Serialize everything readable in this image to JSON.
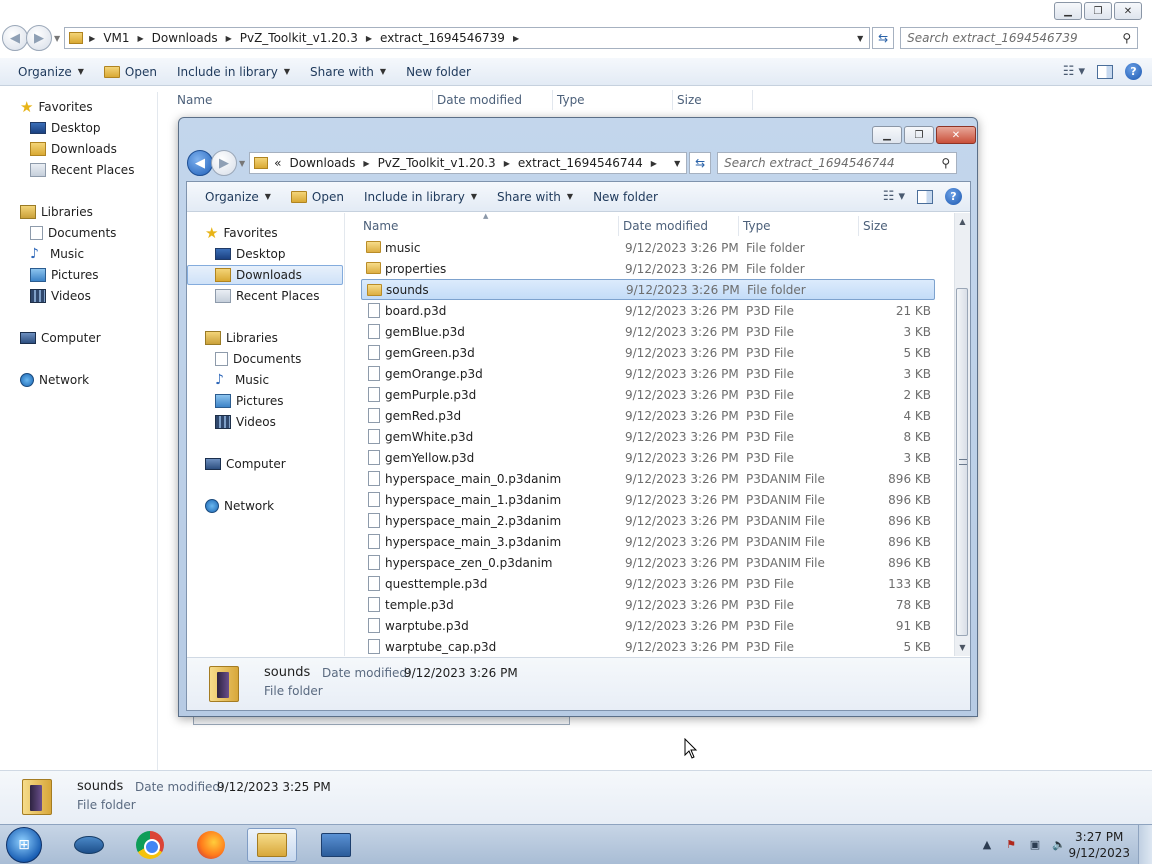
{
  "background_window": {
    "address": {
      "crumbs": [
        "VM1",
        "Downloads",
        "PvZ_Toolkit_v1.20.3",
        "extract_1694546739"
      ]
    },
    "search_placeholder": "Search extract_1694546739",
    "toolbar": {
      "organize": "Organize",
      "open": "Open",
      "include_in_library": "Include in library",
      "share_with": "Share with",
      "new_folder": "New folder"
    },
    "columns": [
      "Name",
      "Date modified",
      "Type",
      "Size"
    ],
    "nav": {
      "favorites": "Favorites",
      "desktop": "Desktop",
      "downloads": "Downloads",
      "recent_places": "Recent Places",
      "libraries": "Libraries",
      "documents": "Documents",
      "music": "Music",
      "pictures": "Pictures",
      "videos": "Videos",
      "computer": "Computer",
      "network": "Network"
    },
    "details": {
      "name": "sounds",
      "date_label": "Date modified:",
      "date_value": "9/12/2023 3:25 PM",
      "type": "File folder"
    }
  },
  "foreground_window": {
    "address": {
      "overflow": "«",
      "crumbs": [
        "Downloads",
        "PvZ_Toolkit_v1.20.3",
        "extract_1694546744"
      ]
    },
    "search_placeholder": "Search extract_1694546744",
    "toolbar": {
      "organize": "Organize",
      "open": "Open",
      "include_in_library": "Include in library",
      "share_with": "Share with",
      "new_folder": "New folder"
    },
    "columns": [
      "Name",
      "Date modified",
      "Type",
      "Size"
    ],
    "nav": {
      "favorites": "Favorites",
      "desktop": "Desktop",
      "downloads": "Downloads",
      "recent_places": "Recent Places",
      "libraries": "Libraries",
      "documents": "Documents",
      "music": "Music",
      "pictures": "Pictures",
      "videos": "Videos",
      "computer": "Computer",
      "network": "Network"
    },
    "files": [
      {
        "name": "music",
        "date": "9/12/2023 3:26 PM",
        "type": "File folder",
        "size": "",
        "kind": "folder"
      },
      {
        "name": "properties",
        "date": "9/12/2023 3:26 PM",
        "type": "File folder",
        "size": "",
        "kind": "folder"
      },
      {
        "name": "sounds",
        "date": "9/12/2023 3:26 PM",
        "type": "File folder",
        "size": "",
        "kind": "folder",
        "selected": true
      },
      {
        "name": "board.p3d",
        "date": "9/12/2023 3:26 PM",
        "type": "P3D File",
        "size": "21 KB",
        "kind": "file"
      },
      {
        "name": "gemBlue.p3d",
        "date": "9/12/2023 3:26 PM",
        "type": "P3D File",
        "size": "3 KB",
        "kind": "file"
      },
      {
        "name": "gemGreen.p3d",
        "date": "9/12/2023 3:26 PM",
        "type": "P3D File",
        "size": "5 KB",
        "kind": "file"
      },
      {
        "name": "gemOrange.p3d",
        "date": "9/12/2023 3:26 PM",
        "type": "P3D File",
        "size": "3 KB",
        "kind": "file"
      },
      {
        "name": "gemPurple.p3d",
        "date": "9/12/2023 3:26 PM",
        "type": "P3D File",
        "size": "2 KB",
        "kind": "file"
      },
      {
        "name": "gemRed.p3d",
        "date": "9/12/2023 3:26 PM",
        "type": "P3D File",
        "size": "4 KB",
        "kind": "file"
      },
      {
        "name": "gemWhite.p3d",
        "date": "9/12/2023 3:26 PM",
        "type": "P3D File",
        "size": "8 KB",
        "kind": "file"
      },
      {
        "name": "gemYellow.p3d",
        "date": "9/12/2023 3:26 PM",
        "type": "P3D File",
        "size": "3 KB",
        "kind": "file"
      },
      {
        "name": "hyperspace_main_0.p3danim",
        "date": "9/12/2023 3:26 PM",
        "type": "P3DANIM File",
        "size": "896 KB",
        "kind": "file"
      },
      {
        "name": "hyperspace_main_1.p3danim",
        "date": "9/12/2023 3:26 PM",
        "type": "P3DANIM File",
        "size": "896 KB",
        "kind": "file"
      },
      {
        "name": "hyperspace_main_2.p3danim",
        "date": "9/12/2023 3:26 PM",
        "type": "P3DANIM File",
        "size": "896 KB",
        "kind": "file"
      },
      {
        "name": "hyperspace_main_3.p3danim",
        "date": "9/12/2023 3:26 PM",
        "type": "P3DANIM File",
        "size": "896 KB",
        "kind": "file"
      },
      {
        "name": "hyperspace_zen_0.p3danim",
        "date": "9/12/2023 3:26 PM",
        "type": "P3DANIM File",
        "size": "896 KB",
        "kind": "file"
      },
      {
        "name": "questtemple.p3d",
        "date": "9/12/2023 3:26 PM",
        "type": "P3D File",
        "size": "133 KB",
        "kind": "file"
      },
      {
        "name": "temple.p3d",
        "date": "9/12/2023 3:26 PM",
        "type": "P3D File",
        "size": "78 KB",
        "kind": "file"
      },
      {
        "name": "warptube.p3d",
        "date": "9/12/2023 3:26 PM",
        "type": "P3D File",
        "size": "91 KB",
        "kind": "file"
      },
      {
        "name": "warptube_cap.p3d",
        "date": "9/12/2023 3:26 PM",
        "type": "P3D File",
        "size": "5 KB",
        "kind": "file"
      }
    ],
    "details": {
      "name": "sounds",
      "date_label": "Date modified:",
      "date_value": "9/12/2023 3:26 PM",
      "type": "File folder"
    }
  },
  "taskbar": {
    "time": "3:27 PM",
    "date": "9/12/2023"
  }
}
